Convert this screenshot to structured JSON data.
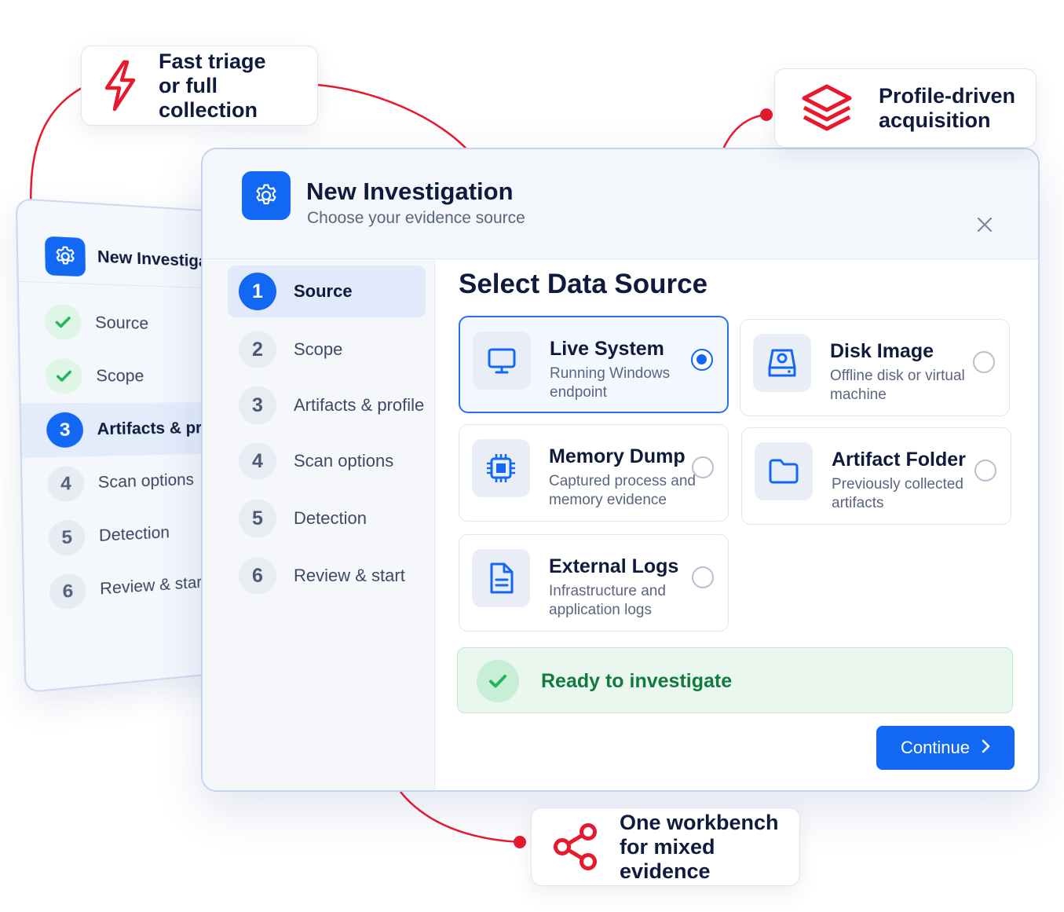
{
  "callouts": {
    "fast_triage": {
      "line1": "Fast triage",
      "line2": "or full collection",
      "icon": "lightning-icon"
    },
    "profile_driven": {
      "line1": "Profile-driven",
      "line2": "acquisition",
      "icon": "layers-icon"
    },
    "one_workbench": {
      "line1": "One workbench",
      "line2": "for mixed evidence",
      "icon": "share-icon"
    }
  },
  "back_window": {
    "title": "New Investigation",
    "steps": [
      {
        "num": "",
        "label": "Source",
        "state": "done"
      },
      {
        "num": "",
        "label": "Scope",
        "state": "done"
      },
      {
        "num": "3",
        "label": "Artifacts & profile",
        "state": "active"
      },
      {
        "num": "4",
        "label": "Scan options",
        "state": "todo"
      },
      {
        "num": "5",
        "label": "Detection",
        "state": "todo"
      },
      {
        "num": "6",
        "label": "Review & start",
        "state": "todo"
      }
    ]
  },
  "main_window": {
    "title": "New Investigation",
    "subtitle": "Choose your evidence source",
    "steps": [
      {
        "num": "1",
        "label": "Source",
        "active": true
      },
      {
        "num": "2",
        "label": "Scope",
        "active": false
      },
      {
        "num": "3",
        "label": "Artifacts & profile",
        "active": false
      },
      {
        "num": "4",
        "label": "Scan options",
        "active": false
      },
      {
        "num": "5",
        "label": "Detection",
        "active": false
      },
      {
        "num": "6",
        "label": "Review & start",
        "active": false
      }
    ],
    "section_title": "Select Data Source",
    "sources": [
      {
        "title": "Live System",
        "desc": "Running Windows endpoint",
        "icon": "monitor-icon",
        "selected": true
      },
      {
        "title": "Disk Image",
        "desc": "Offline disk or virtual machine",
        "icon": "disk-image-icon",
        "selected": false
      },
      {
        "title": "Memory Dump",
        "desc": "Captured process and memory evidence",
        "icon": "chip-icon",
        "selected": false
      },
      {
        "title": "Artifact Folder",
        "desc": "Previously collected artifacts",
        "icon": "folder-icon",
        "selected": false
      },
      {
        "title": "External Logs",
        "desc": "Infrastructure and application logs",
        "icon": "document-icon",
        "selected": false
      }
    ],
    "status_text": "Ready to investigate",
    "continue_label": "Continue"
  },
  "colors": {
    "primary": "#1268f3",
    "accent_red": "#e8192c",
    "success_green": "#22b55b",
    "success_text": "#137a3e"
  }
}
